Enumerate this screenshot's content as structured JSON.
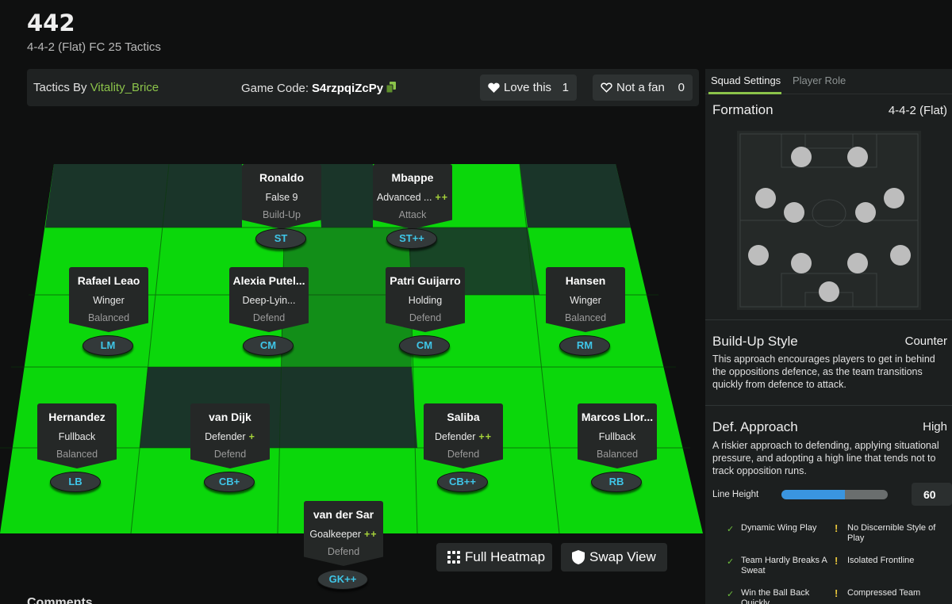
{
  "header": {
    "title": "442",
    "subtitle": "4-4-2 (Flat) FC 25 Tactics"
  },
  "info_bar": {
    "author_prefix": "Tactics By",
    "author_name": "Vitality_Brice",
    "game_code_label": "Game Code:",
    "game_code": "S4rzpqiZcPy",
    "love_label": "Love this",
    "love_count": "1",
    "fan_label": "Not a fan",
    "fan_count": "0"
  },
  "players": [
    {
      "name": "Ronaldo",
      "role": "False 9",
      "plus": "",
      "focus": "Build-Up",
      "position": "ST"
    },
    {
      "name": "Mbappe",
      "role": "Advanced ...",
      "plus": "++",
      "focus": "Attack",
      "position": "ST++"
    },
    {
      "name": "Rafael Leao",
      "role": "Winger",
      "plus": "",
      "focus": "Balanced",
      "position": "LM"
    },
    {
      "name": "Alexia Putel...",
      "role": "Deep-Lyin...",
      "plus": "",
      "focus": "Defend",
      "position": "CM"
    },
    {
      "name": "Patri Guijarro",
      "role": "Holding",
      "plus": "",
      "focus": "Defend",
      "position": "CM"
    },
    {
      "name": "Hansen",
      "role": "Winger",
      "plus": "",
      "focus": "Balanced",
      "position": "RM"
    },
    {
      "name": "Hernandez",
      "role": "Fullback",
      "plus": "",
      "focus": "Balanced",
      "position": "LB"
    },
    {
      "name": "van Dijk",
      "role": "Defender",
      "plus": "+",
      "focus": "Defend",
      "position": "CB+"
    },
    {
      "name": "Saliba",
      "role": "Defender",
      "plus": "++",
      "focus": "Defend",
      "position": "CB++"
    },
    {
      "name": "Marcos Llor...",
      "role": "Fullback",
      "plus": "",
      "focus": "Balanced",
      "position": "RB"
    },
    {
      "name": "van der Sar",
      "role": "Goalkeeper",
      "plus": "++",
      "focus": "Defend",
      "position": "GK++"
    }
  ],
  "actions": {
    "heatmap_label": "Full Heatmap",
    "swap_label": "Swap View"
  },
  "comments_peek": "Comments",
  "side_panel": {
    "tabs": [
      "Squad Settings",
      "Player Role"
    ],
    "formation_label": "Formation",
    "formation_value": "4-4-2 (Flat)",
    "build_up": {
      "title": "Build-Up Style",
      "value": "Counter",
      "description": "This approach encourages players to get in behind the oppositions defence, as the team transitions quickly from defence to attack."
    },
    "def_approach": {
      "title": "Def. Approach",
      "value": "High",
      "description": "A riskier approach to defending, applying situational pressure, and adopting a high line that tends not to track opposition runs."
    },
    "line_height_label": "Line Height",
    "line_height_value": 60,
    "strengths": [
      "Dynamic Wing Play",
      "Team Hardly Breaks A Sweat",
      "Win the Ball Back Quickly"
    ],
    "weaknesses": [
      "No Discernible Style of Play",
      "Isolated Frontline",
      "Compressed Team"
    ]
  },
  "colors": {
    "pitch_bright": "#0bd70b",
    "pitch_dark": "#1a3529",
    "accent_green": "#8bc34a",
    "position_text": "#3fc6e8",
    "slider_fill": "#3a95e0"
  },
  "icons": [
    "copy-icon",
    "heart-icon",
    "heart-outline-icon",
    "grid-icon",
    "shield-icon",
    "check-icon",
    "warning-icon"
  ]
}
